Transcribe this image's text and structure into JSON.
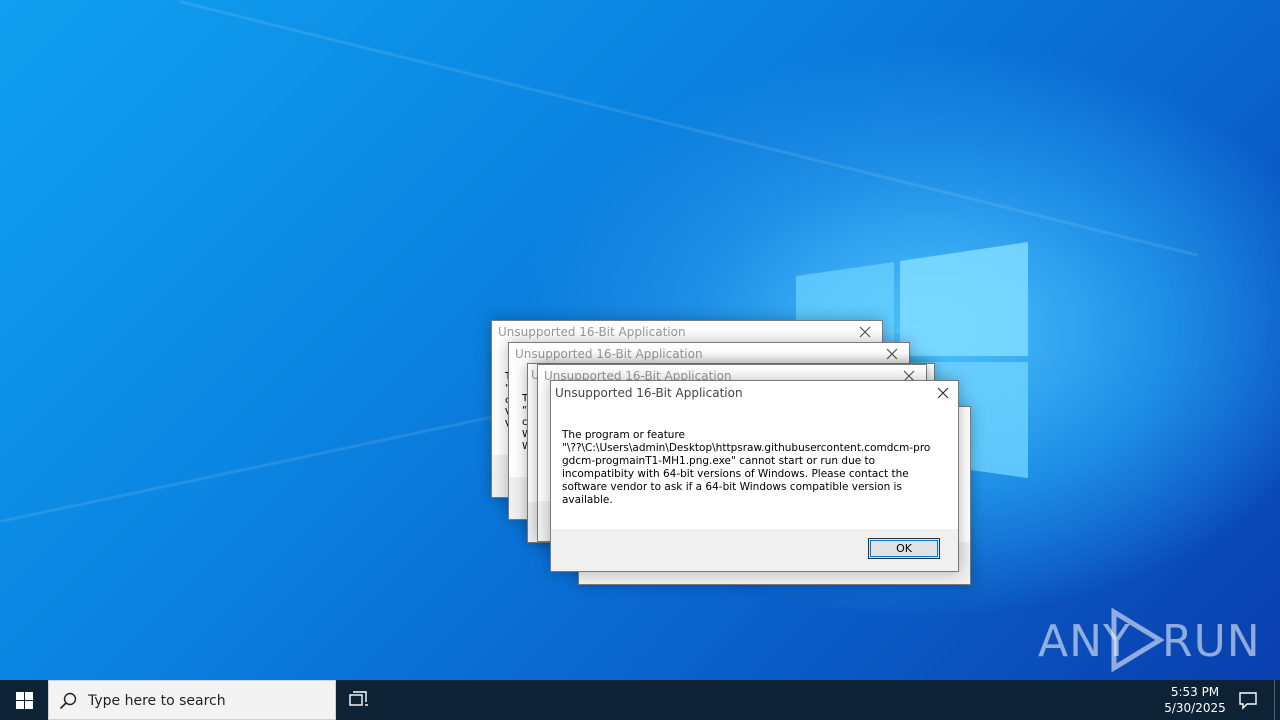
{
  "dialog": {
    "title": "Unsupported 16-Bit Application",
    "message": "The program or feature \"\\??\\C:\\Users\\admin\\Desktop\\httpsraw.githubusercontent.comdcm-progdcm-progmainT1-MH1.png.exe\" cannot start or run due to incompatibity with 64-bit versions of Windows. Please contact the software vendor to ask if a 64-bit Windows compatible version is available.",
    "ok_label": "OK",
    "message_lines": [
      "The program or feature",
      "\"\\??\\C:\\Users\\admin\\Desktop\\httpsraw.githubusercontent.comdcm-pro",
      "gdcm-progmainT1-MH1.png.exe\" cannot start or run due to",
      "incompatibity with 64-bit versions of Windows. Please contact the",
      "software vendor to ask if a 64-bit Windows compatible version is",
      "available."
    ]
  },
  "background_dialog_fragments": {
    "d1": [
      "T",
      "\"",
      "c",
      "V",
      "V"
    ],
    "d2": [
      "T",
      "\"\\",
      "c",
      "W",
      "W"
    ],
    "d3": [
      "U"
    ]
  },
  "watermark": {
    "left": "ANY",
    "right": "RUN"
  },
  "taskbar": {
    "search_placeholder": "Type here to search",
    "time": "5:53 PM",
    "date": "5/30/2025",
    "icons": [
      "windows-start-icon",
      "search-icon",
      "task-view-icon",
      "action-center-icon"
    ]
  },
  "colors": {
    "desktop": "#0b86e2",
    "taskbar": "#0e2236",
    "dialog_bg": "#ffffff",
    "button_bar": "#f0f0f0",
    "focus_outline": "#0078d7"
  }
}
